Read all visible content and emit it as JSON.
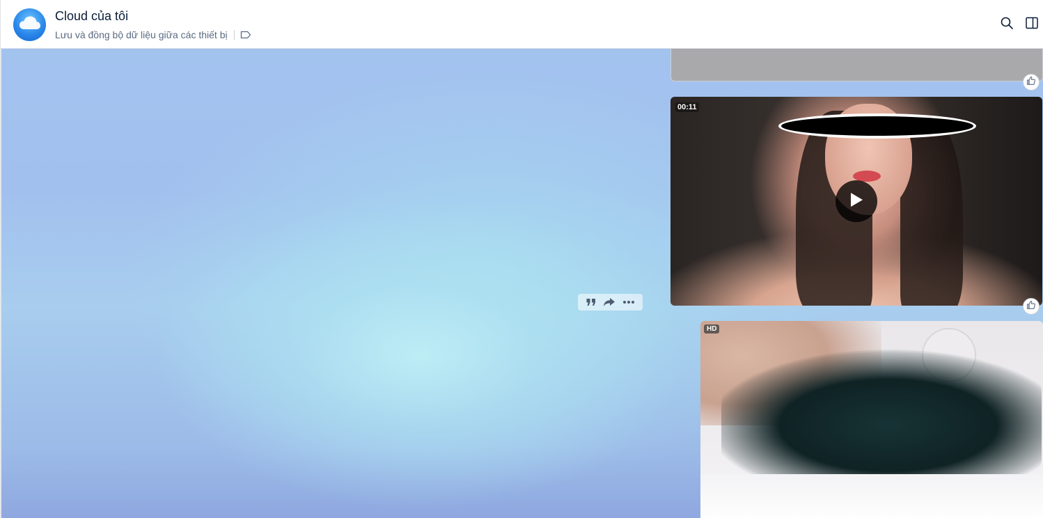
{
  "header": {
    "title": "Cloud của tôi",
    "subtitle": "Lưu và đồng bộ dữ liệu giữa các thiết bị"
  },
  "icons": {
    "avatar": "cloud-icon",
    "tag": "tag-icon",
    "search": "search-icon",
    "panel": "panel-toggle-icon",
    "quote": "quote-icon",
    "forward": "forward-icon",
    "more": "more-icon",
    "play": "play-icon",
    "like": "thumbs-up-icon"
  },
  "media": {
    "video_duration": "00:11",
    "photo_badge": "HD"
  },
  "colors": {
    "accent": "#2b88ea",
    "title_text": "#081c36",
    "subtitle_text": "#5a6981"
  }
}
